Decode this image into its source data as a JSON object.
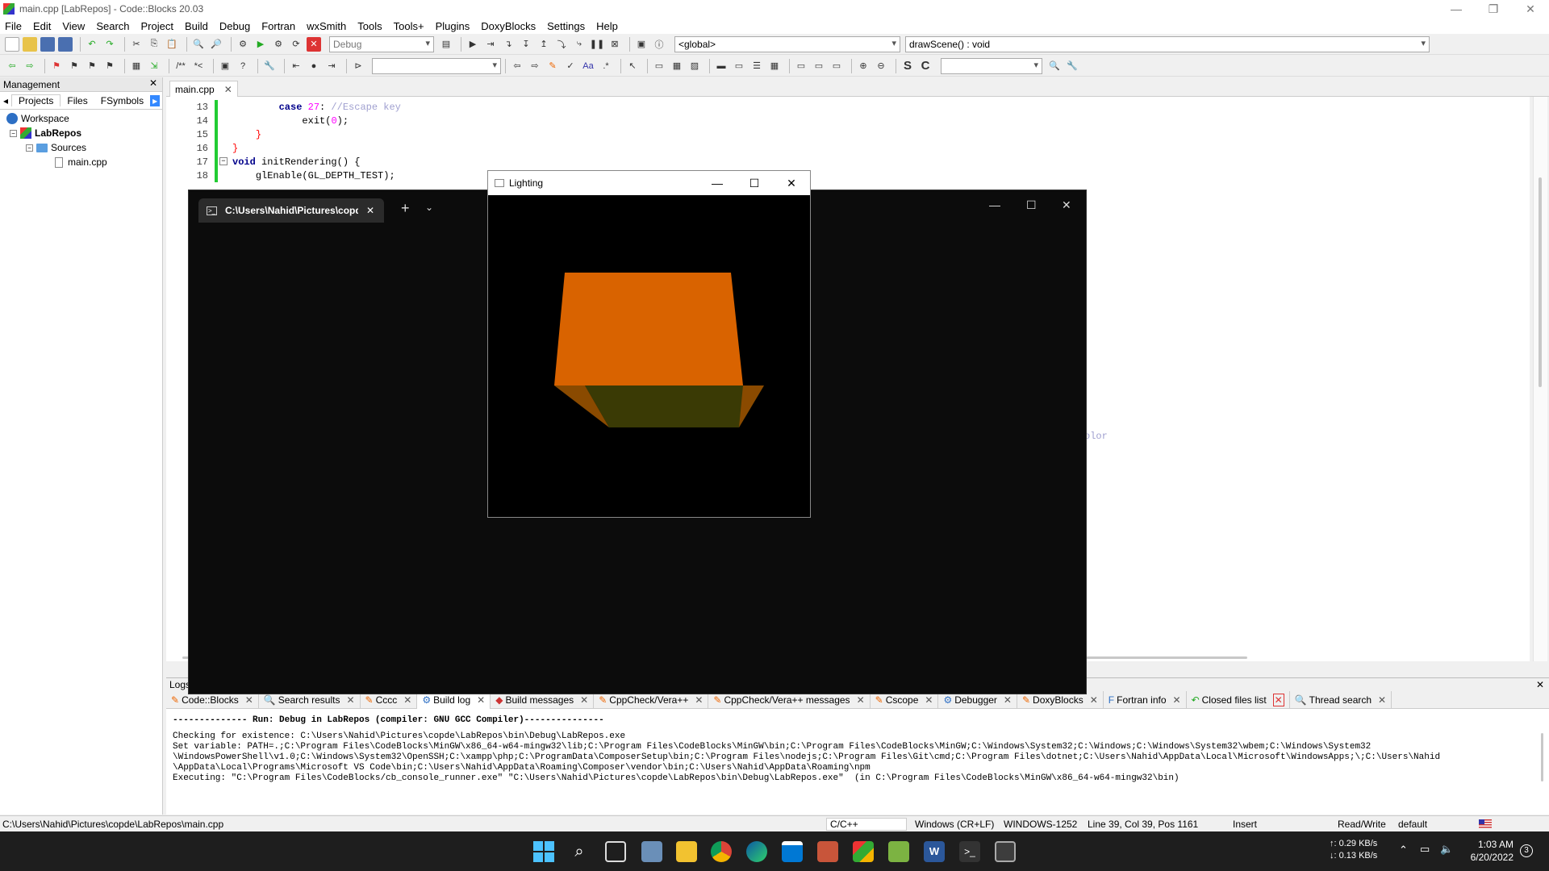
{
  "window": {
    "title": "main.cpp [LabRepos] - Code::Blocks 20.03"
  },
  "menu": [
    "File",
    "Edit",
    "View",
    "Search",
    "Project",
    "Build",
    "Debug",
    "Fortran",
    "wxSmith",
    "Tools",
    "Tools+",
    "Plugins",
    "DoxyBlocks",
    "Settings",
    "Help"
  ],
  "toolbar": {
    "build_target": "Debug",
    "scope": "<global>",
    "function": "drawScene() : void"
  },
  "management": {
    "title": "Management",
    "tabs": [
      "Projects",
      "Files",
      "FSymbols"
    ],
    "tree": {
      "workspace": "Workspace",
      "project": "LabRepos",
      "folder": "Sources",
      "file": "main.cpp"
    }
  },
  "editor": {
    "tab_label": "main.cpp",
    "lines": [
      {
        "n": "13",
        "indent": "        ",
        "kw": "case",
        "num": "27",
        "rest": ":",
        "cmt": " //Escape key"
      },
      {
        "n": "14",
        "indent": "            ",
        "text": "exit(",
        "num": "0",
        "rest": ");"
      },
      {
        "n": "15",
        "indent": "    ",
        "brace": "}"
      },
      {
        "n": "16",
        "indent": "",
        "brace": "}"
      },
      {
        "n": "17",
        "indent": "",
        "kw": "void",
        "text": " initRendering() {"
      },
      {
        "n": "18",
        "indent": "    ",
        "text": "glEnable(GL_DEPTH_TEST);"
      }
    ],
    "clipped_text": "olor"
  },
  "terminal": {
    "tab_title": "C:\\Users\\Nahid\\Pictures\\copd"
  },
  "lighting": {
    "title": "Lighting",
    "cube_top_color": "#d96300",
    "cube_bottom_color": "#3a3a05"
  },
  "logs": {
    "title": "Logs & others",
    "tabs": [
      "Code::Blocks",
      "Search results",
      "Cccc",
      "Build log",
      "Build messages",
      "CppCheck/Vera++",
      "CppCheck/Vera++ messages",
      "Cscope",
      "Debugger",
      "DoxyBlocks",
      "Fortran info",
      "Closed files list",
      "Thread search"
    ],
    "lines": [
      "-------------- Run: Debug in LabRepos (compiler: GNU GCC Compiler)---------------",
      "Checking for existence: C:\\Users\\Nahid\\Pictures\\copde\\LabRepos\\bin\\Debug\\LabRepos.exe",
      "Set variable: PATH=.;C:\\Program Files\\CodeBlocks\\MinGW\\x86_64-w64-mingw32\\lib;C:\\Program Files\\CodeBlocks\\MinGW\\bin;C:\\Program Files\\CodeBlocks\\MinGW;C:\\Windows\\System32;C:\\Windows;C:\\Windows\\System32\\wbem;C:\\Windows\\System32",
      "\\WindowsPowerShell\\v1.0;C:\\Windows\\System32\\OpenSSH;C:\\xampp\\php;C:\\ProgramData\\ComposerSetup\\bin;C:\\Program Files\\nodejs;C:\\Program Files\\Git\\cmd;C:\\Program Files\\dotnet;C:\\Users\\Nahid\\AppData\\Local\\Microsoft\\WindowsApps;\\;C:\\Users\\Nahid",
      "\\AppData\\Local\\Programs\\Microsoft VS Code\\bin;C:\\Users\\Nahid\\AppData\\Roaming\\Composer\\vendor\\bin;C:\\Users\\Nahid\\AppData\\Roaming\\npm",
      "Executing: \"C:\\Program Files\\CodeBlocks/cb_console_runner.exe\" \"C:\\Users\\Nahid\\Pictures\\copde\\LabRepos\\bin\\Debug\\LabRepos.exe\"  (in C:\\Program Files\\CodeBlocks\\MinGW\\x86_64-w64-mingw32\\bin)"
    ]
  },
  "status": {
    "path": "C:\\Users\\Nahid\\Pictures\\copde\\LabRepos\\main.cpp",
    "lang": "C/C++",
    "eol": "Windows (CR+LF)",
    "encoding": "WINDOWS-1252",
    "position": "Line 39, Col 39, Pos 1161",
    "mode": "Insert",
    "rw": "Read/Write",
    "profile": "default"
  },
  "taskbar": {
    "net_up": "↑: 0.29 KB/s",
    "net_down": "↓: 0.13 KB/s",
    "time": "1:03 AM",
    "date": "6/20/2022",
    "notif": "3"
  }
}
